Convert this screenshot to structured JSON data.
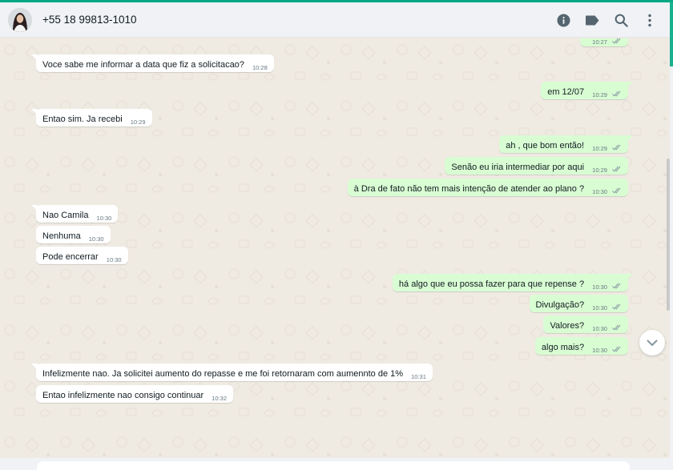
{
  "contact": {
    "name": "+55 18 99813-1010",
    "avatar_icon": "profile-photo"
  },
  "header_icons": [
    "info-icon",
    "label-icon",
    "search-icon",
    "more-vertical-icon"
  ],
  "colors": {
    "accent": "#00a884",
    "outgoing_bubble": "#d9fdd3",
    "incoming_bubble": "#ffffff",
    "background": "#efeae2",
    "tick_gray": "#8696a0"
  },
  "messages": [
    {
      "id": "m0",
      "dir": "out",
      "text": "",
      "time": "10:27",
      "ticks": true
    },
    {
      "id": "m1",
      "dir": "in",
      "text": "Voce sabe me informar a data  que fiz a solicitacao?",
      "time": "10:28"
    },
    {
      "id": "m2",
      "dir": "out",
      "text": "em 12/07",
      "time": "10:29",
      "ticks": true
    },
    {
      "id": "m3",
      "dir": "in",
      "text": "Entao sim. Ja recebi",
      "time": "10:29"
    },
    {
      "id": "m4",
      "dir": "out",
      "text": "ah , que bom então!",
      "time": "10:29",
      "ticks": true
    },
    {
      "id": "m5",
      "dir": "out",
      "text": "Senão eu iria intermediar por aqui",
      "time": "10:29",
      "ticks": true
    },
    {
      "id": "m6",
      "dir": "out",
      "text": "à Dra de fato não tem mais intenção de atender ao plano ?",
      "time": "10:30",
      "ticks": true
    },
    {
      "id": "m7",
      "dir": "in",
      "text": "Nao Camila",
      "time": "10:30"
    },
    {
      "id": "m8",
      "dir": "in",
      "text": "Nenhuma",
      "time": "10:30"
    },
    {
      "id": "m9",
      "dir": "in",
      "text": "Pode encerrar",
      "time": "10:30"
    },
    {
      "id": "m10",
      "dir": "out",
      "text": "há algo que eu possa fazer para que repense ?",
      "time": "10:30",
      "ticks": true
    },
    {
      "id": "m11",
      "dir": "out",
      "text": "Divulgação?",
      "time": "10:30",
      "ticks": true
    },
    {
      "id": "m12",
      "dir": "out",
      "text": "Valores?",
      "time": "10:30",
      "ticks": true
    },
    {
      "id": "m13",
      "dir": "out",
      "text": "algo mais?",
      "time": "10:30",
      "ticks": true
    },
    {
      "id": "m14",
      "dir": "in",
      "text": "Infelizmente nao. Ja solicitei aumento do repasse e me foi retornaram com aumennto de 1%",
      "time": "10:31"
    },
    {
      "id": "m15",
      "dir": "in",
      "text": "Entao infelizmente nao consigo continuar",
      "time": "10:32"
    }
  ],
  "scroll_down_icon": "chevron-down-icon"
}
